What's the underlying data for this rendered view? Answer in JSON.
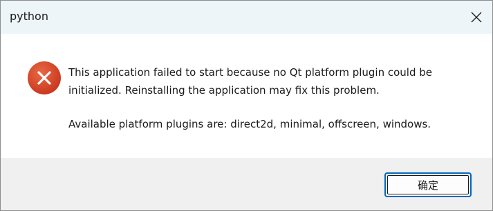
{
  "window": {
    "title": "python"
  },
  "icons": {
    "close": "close-icon",
    "error": "error-icon"
  },
  "colors": {
    "error_icon": "#d9452b",
    "button_border": "#0067c0",
    "titlebar_bg": "#eef5f9",
    "footer_bg": "#f0f0f0"
  },
  "message": {
    "line1": "This application failed to start because no Qt platform plugin could be",
    "line2": "initialized. Reinstalling the application may fix this problem.",
    "line3": "Available platform plugins are: direct2d, minimal, offscreen, windows."
  },
  "buttons": {
    "ok_label": "确定"
  }
}
